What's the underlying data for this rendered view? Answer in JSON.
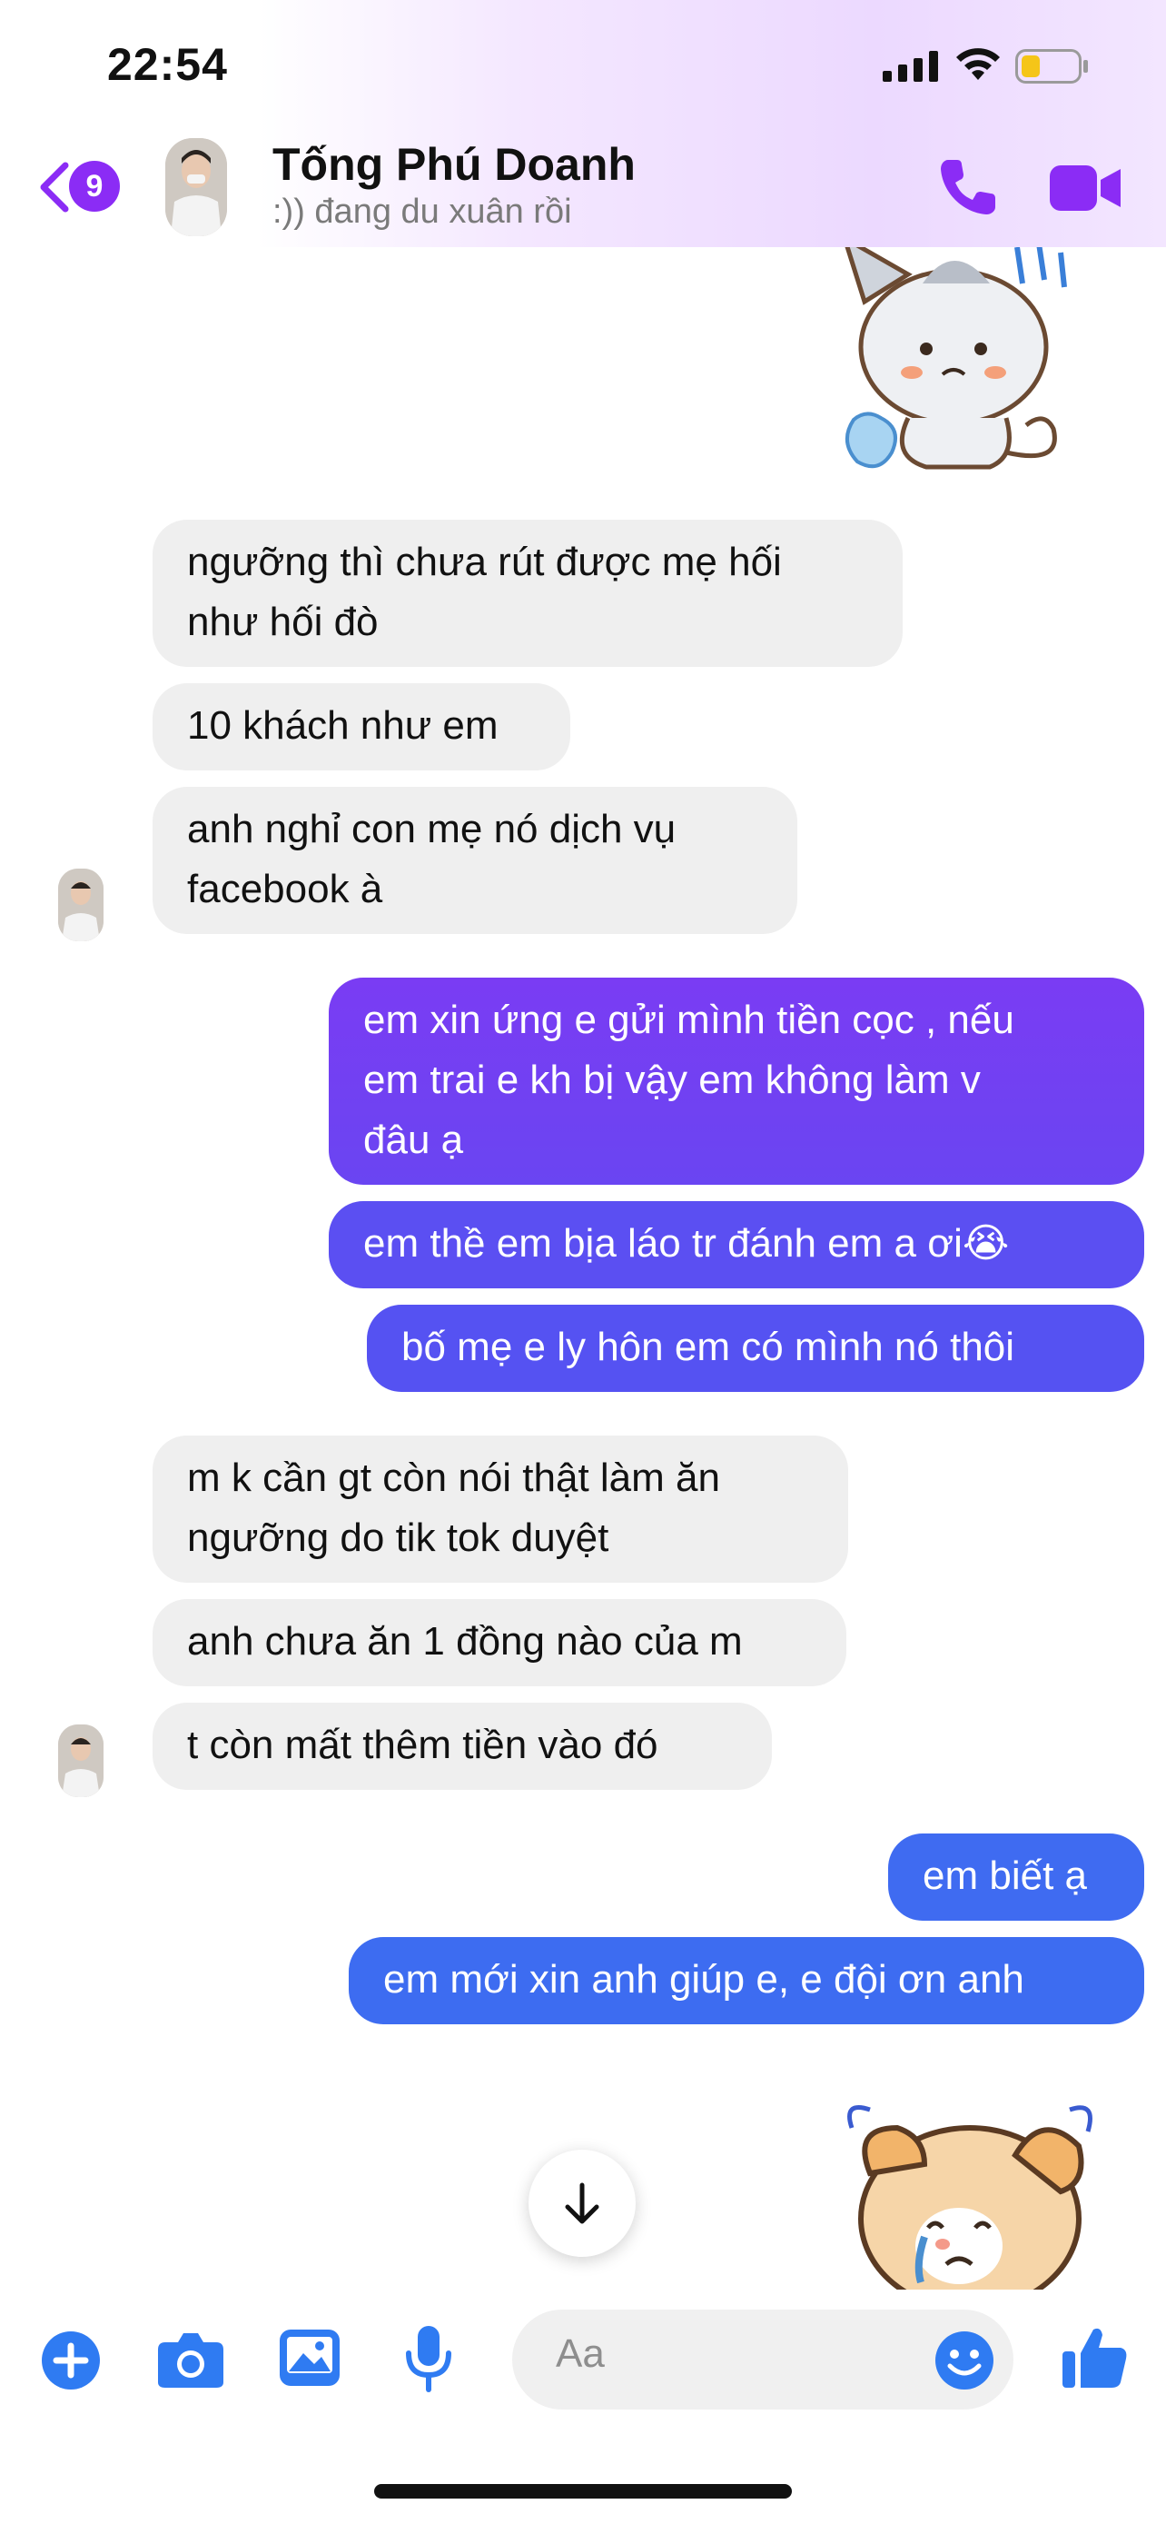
{
  "status_bar": {
    "time": "22:54"
  },
  "header": {
    "back_badge": "9",
    "contact_name": "Tống Phú Doanh",
    "contact_status": ":)) đang du xuân rồi"
  },
  "messages": [
    {
      "side": "in",
      "text": "ngưỡng thì chưa rút được mẹ hối\nnhư hối đò"
    },
    {
      "side": "in",
      "text": "10 khách như em"
    },
    {
      "side": "in",
      "text": "anh nghỉ con mẹ nó dịch vụ\nfacebook à"
    },
    {
      "side": "out",
      "text": "em xin ứng e gửi mình tiền cọc , nếu\nem trai e kh bị vậy em không làm v\nđâu ạ"
    },
    {
      "side": "out",
      "text": "em thề em bịa láo tr đánh em a ơi😭"
    },
    {
      "side": "out",
      "text": "bố mẹ e ly hôn em có mình nó thôi"
    },
    {
      "side": "in",
      "text": "m k cần gt còn nói thật làm ăn\nngưỡng do tik tok duyệt"
    },
    {
      "side": "in",
      "text": "anh chưa ăn 1 đồng nào của m"
    },
    {
      "side": "in",
      "text": "t còn mất thêm tiền vào đó"
    },
    {
      "side": "out",
      "text": "em biết ạ"
    },
    {
      "side": "out",
      "text": "em mới xin anh giúp e, e đội ơn anh"
    }
  ],
  "composer": {
    "placeholder": "Aa"
  },
  "colors": {
    "accent": "#8b2cf5",
    "outgoing_top": "#7a3cf3",
    "outgoing_bottom": "#3d6cf1",
    "incoming_bg": "#efefef",
    "icon_blue": "#2f7bf2"
  },
  "icons": [
    "back-chevron-icon",
    "phone-icon",
    "video-camera-icon",
    "arrow-down-icon",
    "plus-icon",
    "camera-icon",
    "image-icon",
    "microphone-icon",
    "emoji-icon",
    "thumbs-up-icon"
  ]
}
